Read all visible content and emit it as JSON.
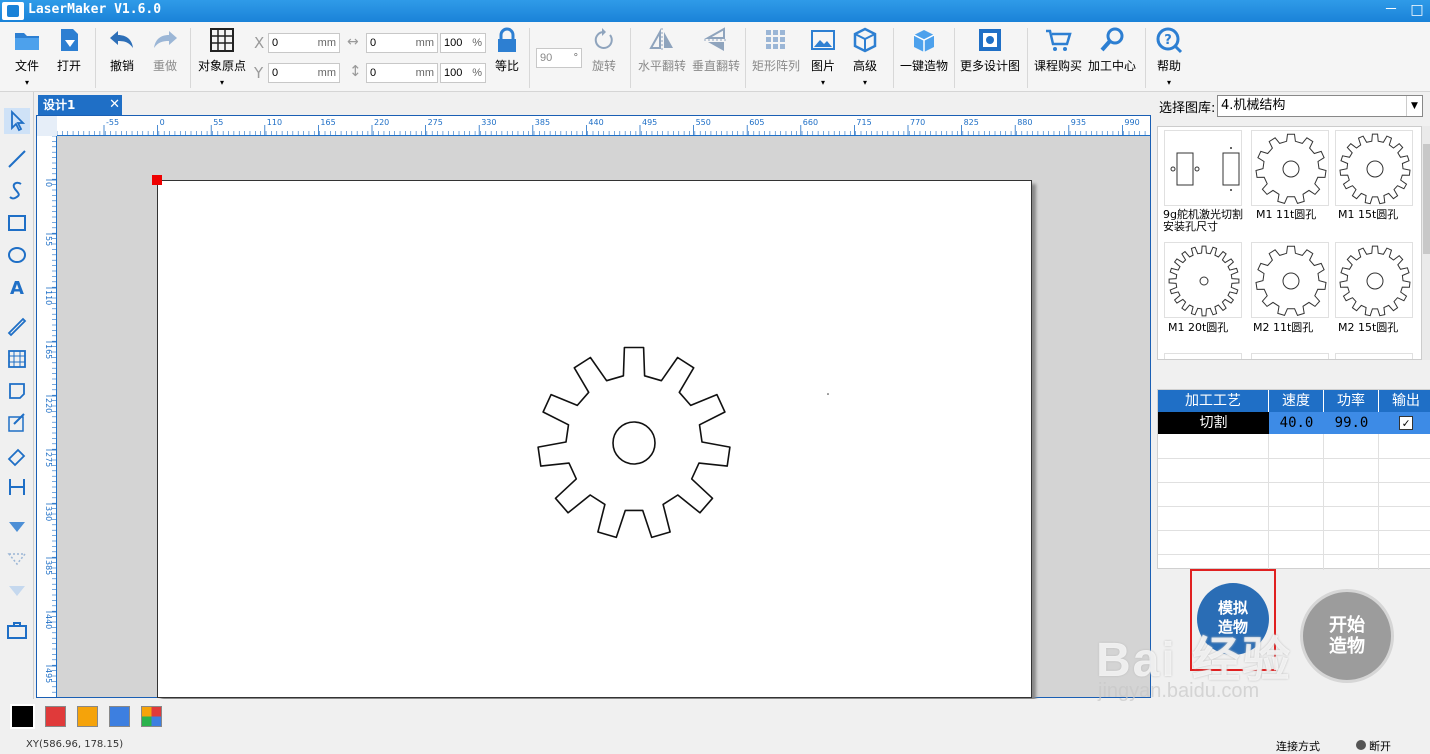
{
  "app": {
    "title": "LaserMaker V1.6.0"
  },
  "window": {
    "min": "－",
    "max": "□"
  },
  "toolbar": {
    "file": "文件",
    "open": "打开",
    "undo": "撤销",
    "redo": "重做",
    "origin": "对象原点",
    "x_label": "X",
    "y_label": "Y",
    "x_value": "0",
    "y_value": "0",
    "unit": "mm",
    "w_value": "0",
    "h_value": "0",
    "w_pct": "100",
    "h_pct": "100",
    "pct": "%",
    "ratio": "等比",
    "rotate_value": "90",
    "rotate_unit": "°",
    "rotate": "旋转",
    "hflip": "水平翻转",
    "vflip": "垂直翻转",
    "array": "矩形阵列",
    "image": "图片",
    "advanced": "高级",
    "oneclick": "一键造物",
    "more": "更多设计图",
    "course": "课程购买",
    "center": "加工中心",
    "help": "帮助"
  },
  "tab": {
    "label": "设计1",
    "close": "✕"
  },
  "ruler": {
    "h_ticks": [
      "-55",
      "0",
      "55",
      "110",
      "165",
      "220",
      "275",
      "330",
      "385",
      "440",
      "495",
      "550",
      "605",
      "660",
      "715",
      "770",
      "825",
      "880",
      "935",
      "990"
    ],
    "v_ticks": [
      "0",
      "55",
      "110",
      "165",
      "220",
      "275",
      "330",
      "385",
      "440",
      "495"
    ]
  },
  "library": {
    "label": "选择图库:",
    "selected": "4.机械结构",
    "items": [
      {
        "caption": "9g舵机激光切割安装孔尺寸"
      },
      {
        "caption": "M1 11t圆孔"
      },
      {
        "caption": "M1 15t圆孔"
      },
      {
        "caption": "M1 20t圆孔"
      },
      {
        "caption": "M2 11t圆孔"
      },
      {
        "caption": "M2 15t圆孔"
      }
    ]
  },
  "layers": {
    "headers": [
      "加工工艺",
      "速度",
      "功率",
      "输出"
    ],
    "rows": [
      {
        "process": "切割",
        "speed": "40.0",
        "power": "99.0",
        "output": "✓"
      }
    ]
  },
  "buttons": {
    "simulate": "模拟造物",
    "start": "开始造物"
  },
  "colors": {
    "swatches": [
      "#000000",
      "#e03a3a",
      "#f5a30a",
      "#3d7fe0",
      "multi"
    ]
  },
  "status": {
    "coords": "XY(586.96, 178.15)",
    "connection": "连接方式",
    "disconnected": "断开"
  },
  "watermark": {
    "text": "Bai 经验",
    "url": "jingyan.baidu.com"
  }
}
